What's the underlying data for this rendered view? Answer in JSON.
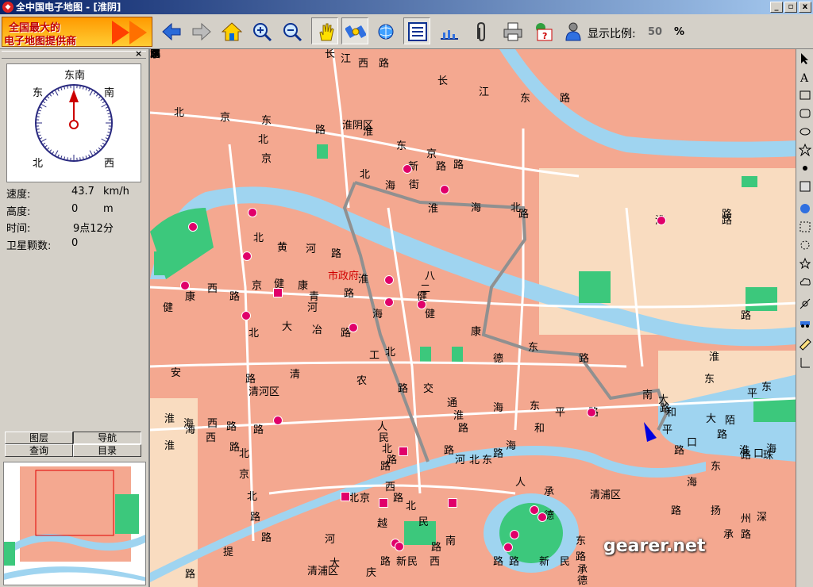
{
  "window": {
    "title": "全中国电子地图 - [淮阴]",
    "min_label": "_",
    "max_label": "▫",
    "close_label": "x"
  },
  "banner": {
    "line1": "全国最大的",
    "line2": "电子地图提供商"
  },
  "toolbar": {
    "icons": [
      "back-arrow-icon",
      "forward-arrow-icon",
      "home-icon",
      "zoom-in-icon",
      "zoom-out-icon",
      "pan-hand-icon",
      "satellite-icon",
      "globe-network-icon",
      "list-icon",
      "chart-icon",
      "paperclip-icon",
      "printer-icon",
      "calendar-help-icon",
      "person-icon"
    ],
    "scale_label": "显示比例:",
    "scale_value": "50",
    "scale_unit": "%"
  },
  "left_panel": {
    "close": "×",
    "compass": {
      "heading": "东南",
      "dir_east": "东",
      "dir_south": "南",
      "dir_north": "北",
      "dir_west": "西"
    },
    "speed_label": "速度:",
    "speed_value": "43.7",
    "speed_unit": "km/h",
    "altitude_label": "高度:",
    "altitude_value": "0",
    "altitude_unit": "m",
    "time_label": "时间:",
    "time_value": "9点12分",
    "satellites_label": "卫星颗数:",
    "satellites_value": "0",
    "tabs": [
      "图层",
      "导航",
      "查询",
      "目录"
    ]
  },
  "map": {
    "labels": [
      "长",
      "江",
      "西",
      "路",
      "长",
      "江",
      "东",
      "路",
      "北",
      "京",
      "东",
      "路",
      "淮阴区",
      "淮",
      "北",
      "京",
      "东",
      "路",
      "北",
      "京",
      "路",
      "海",
      "新",
      "街",
      "淮",
      "海",
      "北",
      "路",
      "路",
      "淮",
      "路",
      "北",
      "黄",
      "河",
      "路",
      "市政府",
      "淮",
      "八",
      "二",
      "健",
      "健",
      "康",
      "西",
      "路",
      "京",
      "健",
      "康",
      "青",
      "河",
      "路",
      "北",
      "大",
      "冶",
      "路",
      "海",
      "健",
      "康",
      "东",
      "路",
      "安",
      "路",
      "清",
      "工",
      "北",
      "农",
      "路",
      "交",
      "德",
      "淮",
      "清河区",
      "海",
      "西",
      "路",
      "路",
      "通",
      "淮",
      "路",
      "海",
      "东",
      "平",
      "和",
      "路",
      "海",
      "路",
      "淮",
      "海",
      "西",
      "路",
      "人",
      "民",
      "北",
      "路",
      "路",
      "河",
      "北",
      "东",
      "路",
      "北",
      "京",
      "北",
      "路",
      "北",
      "京",
      "西",
      "路",
      "北",
      "人",
      "承",
      "德",
      "清浦区",
      "越",
      "民",
      "河",
      "提",
      "路",
      "南",
      "路",
      "清浦区",
      "大",
      "庆",
      "路",
      "新",
      "民",
      "西",
      "路",
      "路",
      "新",
      "民",
      "东",
      "路",
      "承",
      "德",
      "路",
      "路",
      "淮",
      "大",
      "东",
      "平",
      "东",
      "大",
      "口",
      "路",
      "淮",
      "海",
      "东",
      "路",
      "珠",
      "海",
      "路",
      "扬",
      "承",
      "州",
      "路",
      "深",
      "南",
      "路",
      "和",
      "平",
      "路",
      "陌",
      "口",
      "国",
      "清",
      "北",
      "京",
      "路",
      "京",
      "路",
      "东",
      "路"
    ]
  },
  "watermark": "gearer.net"
}
